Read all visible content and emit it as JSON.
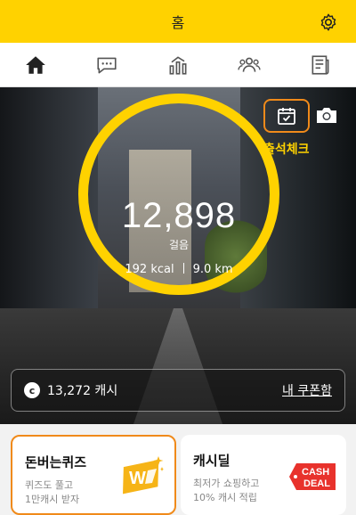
{
  "header": {
    "title": "홈",
    "settings_icon": "gear-icon"
  },
  "tabs": [
    {
      "name": "tab-home",
      "icon": "home-icon",
      "active": true
    },
    {
      "name": "tab-chat",
      "icon": "chat-icon",
      "active": false
    },
    {
      "name": "tab-stats",
      "icon": "stats-icon",
      "active": false
    },
    {
      "name": "tab-friends",
      "icon": "friends-icon",
      "active": false
    },
    {
      "name": "tab-news",
      "icon": "news-icon",
      "active": false
    }
  ],
  "hero": {
    "steps": "12,898",
    "steps_unit": "걸음",
    "kcal": "192 kcal",
    "distance": "9.0 km",
    "attendance_label": "출석체크"
  },
  "cash": {
    "coin_symbol": "c",
    "amount": "13,272 캐시",
    "coupon_link": "내 쿠폰함"
  },
  "cards": {
    "quiz": {
      "title": "돈버는퀴즈",
      "subtitle": "퀴즈도 풀고\n1만캐시 받자"
    },
    "deal": {
      "title": "캐시딜",
      "subtitle": "최저가 쇼핑하고\n10% 캐시 적립",
      "logo_top": "CASH",
      "logo_bottom": "DEAL"
    }
  },
  "colors": {
    "brand_yellow": "#ffd200",
    "highlight_orange": "#f08a1a",
    "deal_red": "#e8322c"
  }
}
